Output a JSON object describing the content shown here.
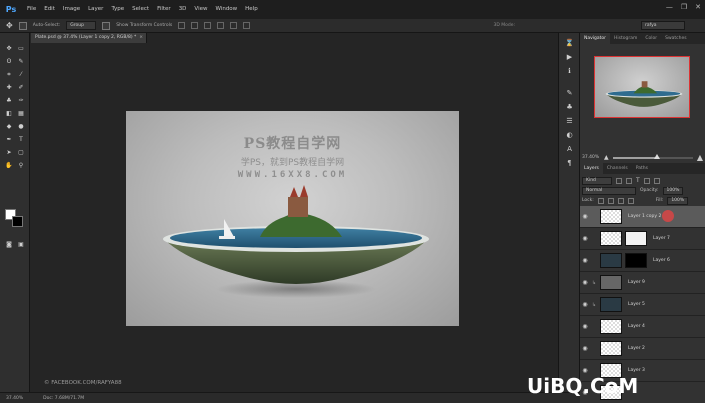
{
  "app": {
    "logo": "Ps"
  },
  "menu": [
    "File",
    "Edit",
    "Image",
    "Layer",
    "Type",
    "Select",
    "Filter",
    "3D",
    "View",
    "Window",
    "Help"
  ],
  "window_controls": [
    "—",
    "❐",
    "✕"
  ],
  "options_bar": {
    "auto_select": "Auto-Select:",
    "auto_select_value": "Group",
    "transform_controls": "Show Transform Controls",
    "mode": "3D Mode:",
    "workspace": "rafya"
  },
  "document_tab": {
    "title": "Plate.psd @ 37.4% (Layer 1 copy 2, RGB/8) *",
    "close": "×"
  },
  "canvas": {
    "watermark_title": "PS教程自学网",
    "watermark_sub": "学PS，就到PS教程自学网",
    "watermark_url": "WWW.16XX8.COM"
  },
  "credit": "© FACEBOOK.COM/RAFYA88",
  "status_bar": {
    "zoom": "37.40%",
    "doc": "Doc: 7.68M/71.7M"
  },
  "colors": {
    "foreground": "#ffffff",
    "background": "#000000",
    "accent_selection": "#5b5b5b",
    "nav_frame": "#dd3333"
  },
  "navigator": {
    "tabs": [
      "Navigator",
      "Histogram",
      "Color",
      "Swatches"
    ],
    "zoom": "37.40%",
    "zoom_fraction": 0.55
  },
  "layers_panel": {
    "tabs": [
      "Layers",
      "Channels",
      "Paths"
    ],
    "kind": "Kind",
    "blend_mode": "Normal",
    "opacity_label": "Opacity:",
    "opacity": "100%",
    "lock_label": "Lock:",
    "fill_label": "Fill:",
    "fill": "100%",
    "layers": [
      {
        "name": "Layer 1 copy 2",
        "thumb": "transparent",
        "mask": "",
        "selected": true,
        "clipped": false
      },
      {
        "name": "Layer 7",
        "thumb": "transparent",
        "mask": "white",
        "selected": false,
        "clipped": false
      },
      {
        "name": "Layer 6",
        "thumb": "dark",
        "mask": "black",
        "selected": false,
        "clipped": false
      },
      {
        "name": "Layer 9",
        "thumb": "gray",
        "mask": "",
        "selected": false,
        "clipped": true
      },
      {
        "name": "Layer 5",
        "thumb": "dark",
        "mask": "",
        "selected": false,
        "clipped": true
      },
      {
        "name": "Layer 4",
        "thumb": "transparent",
        "mask": "",
        "selected": false,
        "clipped": false
      },
      {
        "name": "Layer 2",
        "thumb": "transparent",
        "mask": "",
        "selected": false,
        "clipped": false
      },
      {
        "name": "Layer 3",
        "thumb": "transparent",
        "mask": "",
        "selected": false,
        "clipped": false
      },
      {
        "name": "",
        "thumb": "transparent",
        "mask": "",
        "selected": false,
        "clipped": false
      }
    ]
  },
  "site_logo": "UiBQ.CoM"
}
